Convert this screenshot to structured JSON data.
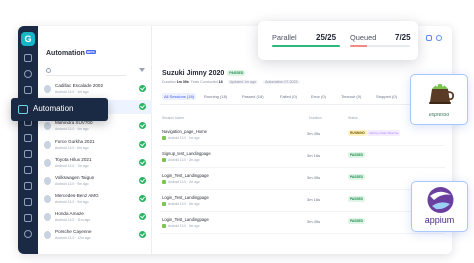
{
  "sidebar": {
    "logo": "G",
    "icons": [
      "grid-icon",
      "clock-icon",
      "layers-icon",
      "automation-icon",
      "play-icon",
      "box-icon",
      "settings-icon",
      "box-icon",
      "chart-icon",
      "users-icon",
      "calendar-icon",
      "help-icon",
      "user-icon"
    ]
  },
  "sessions_panel": {
    "title": "Automation",
    "beta": "BETA",
    "devices": [
      {
        "name": "Cadillac Escalade 2002",
        "sub": "Android 13.0 · 1m ago"
      },
      {
        "name": "Suzuki Jimny 2020",
        "sub": "Android 13.0 · 2m ago"
      },
      {
        "name": "Mahindra XUV700",
        "sub": "Android 13.0 · 4m ago"
      },
      {
        "name": "Force Gurkha 2021",
        "sub": "Android 13.0 · 6m ago"
      },
      {
        "name": "Toyota Hilux 2021",
        "sub": "Android 13.0 · 7m ago"
      },
      {
        "name": "Volkswagen Taigun",
        "sub": "Android 13.0 · 9m ago"
      },
      {
        "name": "Mercedes-Benz AMG",
        "sub": "Android 13.0 · 9m ago"
      },
      {
        "name": "Honda Amaze",
        "sub": "Android 13.0 · 11m ago"
      },
      {
        "name": "Porsche Cayenne",
        "sub": "Android 13.0 · 12m ago"
      }
    ],
    "active_index": 1
  },
  "build": {
    "title": "Suzuki Jimny 2020",
    "status": "PASSED",
    "duration_label": "Duration",
    "duration": "1m 39s",
    "tests_label": "Tests Conducted",
    "tests": "18",
    "chip1": "Updated 1m ago",
    "chip2": "Automation 07-2023"
  },
  "tabs": [
    {
      "label": "All Sessions (18)",
      "active": true
    },
    {
      "label": "Running (18)"
    },
    {
      "label": "Passed (18)"
    },
    {
      "label": "Failed (0)"
    },
    {
      "label": "Error (0)"
    },
    {
      "label": "Timeout (0)"
    },
    {
      "label": "Stopped (0)"
    },
    {
      "label": "Others (0)"
    }
  ],
  "table": {
    "headers": {
      "name": "Session Name",
      "duration": "Duration",
      "status": "Status"
    },
    "rows": [
      {
        "name": "Navigation_page_Home",
        "sub": "Android 13.0 · 1m ago",
        "duration": "3m 45s",
        "status": "RUNNING",
        "note": "Visit by Ishan Sharma"
      },
      {
        "name": "Signup_test_Landingpage",
        "sub": "Android 13.0 · 2m ago",
        "duration": "3m 16s",
        "status": "PASSED",
        "note": ""
      },
      {
        "name": "Login_Test_Landingpage",
        "sub": "Android 13.0 · 2m ago",
        "duration": "3m 45s",
        "status": "PASSED",
        "note": ""
      },
      {
        "name": "Login_Test_Landingpage",
        "sub": "Android 13.0 · 3m ago",
        "duration": "3m 16s",
        "status": "PASSED",
        "note": ""
      },
      {
        "name": "Login_Test_Landingpage",
        "sub": "Android 13.0 · 3m ago",
        "duration": "3m 45s",
        "status": "PASSED",
        "note": ""
      }
    ]
  },
  "concurrency": {
    "parallel_label": "Parallel",
    "parallel_value": "25/25",
    "parallel_fraction": 1.0,
    "queued_label": "Queued",
    "queued_value": "7/25",
    "queued_fraction": 0.28,
    "parallel_color": "#2db87d",
    "queued_color": "#f28b82"
  },
  "automation_tag": {
    "label": "Automation"
  },
  "frameworks": {
    "espresso": "espresso",
    "appium": "appium"
  }
}
